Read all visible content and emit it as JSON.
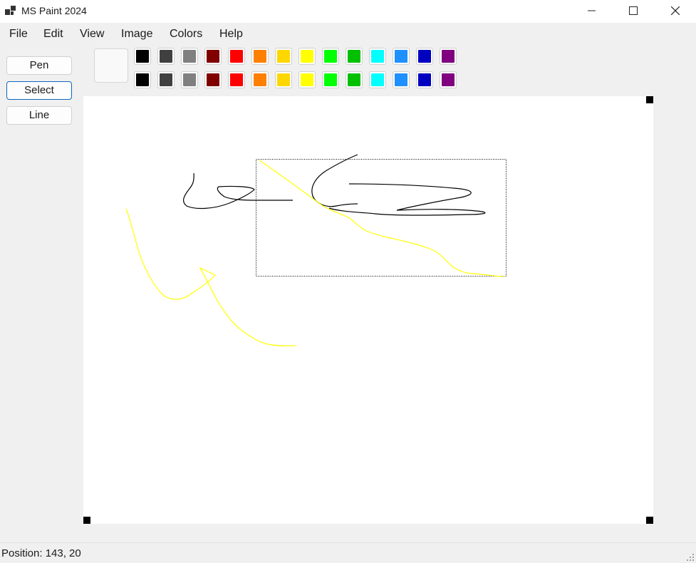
{
  "window": {
    "title": "MS Paint 2024"
  },
  "menu": [
    "File",
    "Edit",
    "View",
    "Image",
    "Colors",
    "Help"
  ],
  "tools": [
    {
      "label": "Pen",
      "selected": false
    },
    {
      "label": "Select",
      "selected": true
    },
    {
      "label": "Line",
      "selected": false
    }
  ],
  "current_color": "#f9f9f9",
  "palette": {
    "row1": [
      "#000000",
      "#404040",
      "#808080",
      "#800000",
      "#ff0000",
      "#ff8000",
      "#ffd700",
      "#ffff00",
      "#00ff00",
      "#00c000",
      "#00ffff",
      "#1e90ff",
      "#0000c0",
      "#800080"
    ],
    "row2": [
      "#000000",
      "#404040",
      "#808080",
      "#800000",
      "#ff0000",
      "#ff8000",
      "#ffd700",
      "#ffff00",
      "#00ff00",
      "#00c000",
      "#00ffff",
      "#1e90ff",
      "#0000c0",
      "#800080"
    ]
  },
  "stroke_colors": {
    "black": "#000000",
    "yellow": "#ffff00"
  },
  "status": {
    "position": "Position: 143, 20"
  }
}
